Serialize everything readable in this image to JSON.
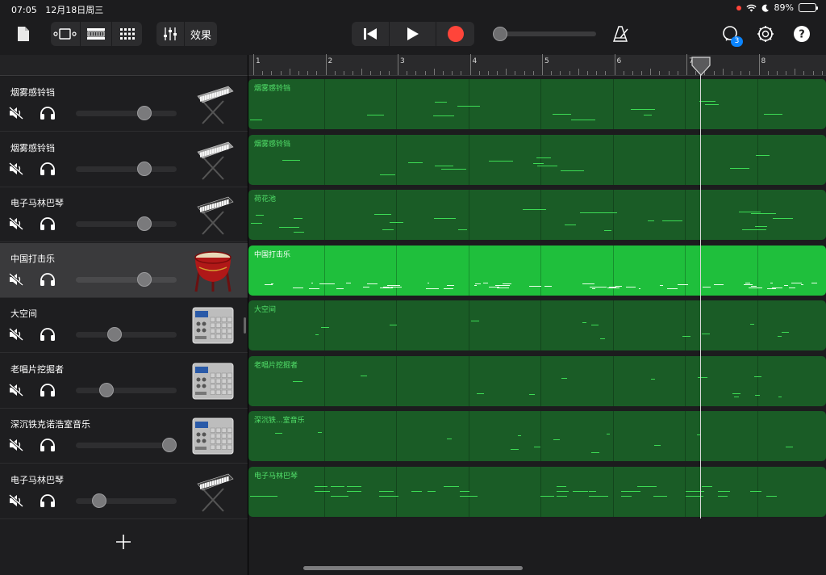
{
  "status": {
    "time": "07:05",
    "date": "12月18日周三",
    "battery": "89%",
    "battery_level": 0.89
  },
  "colors": {
    "accent_record": "#ff453a",
    "region": "#1a5c26",
    "region_selected": "#1fbf3c",
    "note": "#3ddc55"
  },
  "toolbar": {
    "effects_label": "效果",
    "notification_count": "3",
    "position": 0.0
  },
  "ruler": {
    "bars": [
      "1",
      "2",
      "3",
      "4",
      "5",
      "6",
      "7",
      "8"
    ]
  },
  "tracks": [
    {
      "name": "烟雾感铃铛",
      "volume": 0.68,
      "instrument": "keyboard",
      "region": "烟雾感铃铛"
    },
    {
      "name": "烟雾感铃铛",
      "volume": 0.68,
      "instrument": "keyboard",
      "region": "烟雾感铃铛"
    },
    {
      "name": "电子马林巴琴",
      "volume": 0.68,
      "instrument": "keyboard-dark",
      "region": "荷花池"
    },
    {
      "name": "中国打击乐",
      "volume": 0.68,
      "instrument": "drum",
      "region": "中国打击乐",
      "selected": true
    },
    {
      "name": "大空间",
      "volume": 0.38,
      "instrument": "drum-machine",
      "region": "大空间"
    },
    {
      "name": "老唱片挖掘者",
      "volume": 0.3,
      "instrument": "drum-machine",
      "region": "老唱片挖掘者"
    },
    {
      "name": "深沉铁克诺浩室音乐",
      "volume": 0.93,
      "instrument": "drum-machine",
      "region": "深沉铁...室音乐"
    },
    {
      "name": "电子马林巴琴",
      "volume": 0.23,
      "instrument": "keyboard-dark",
      "region": "电子马林巴琴"
    }
  ],
  "playhead_bar": 7.2
}
